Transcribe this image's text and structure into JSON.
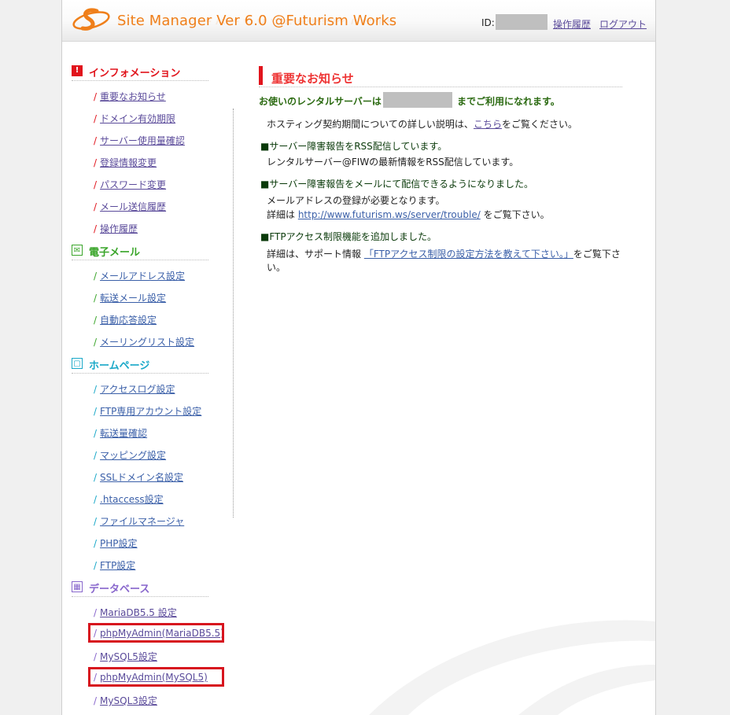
{
  "header": {
    "app_title": "Site Manager Ver 6.0 @Futurism Works",
    "id_label": "ID:",
    "history_link": "操作履歴",
    "logout_link": "ログアウト"
  },
  "sidebar": {
    "sections": [
      {
        "title": "インフォメーション",
        "icon": "exclamation-icon",
        "color": "#e1141c",
        "items": [
          "重要なお知らせ",
          "ドメイン有効期限",
          "サーバー使用量確認",
          "登録情報変更",
          "パスワード変更",
          "メール送信履歴",
          "操作履歴"
        ]
      },
      {
        "title": "電子メール",
        "icon": "envelope-icon",
        "color": "#3aa52a",
        "items": [
          "メールアドレス設定",
          "転送メール設定",
          "自動応答設定",
          "メーリングリスト設定"
        ]
      },
      {
        "title": "ホームページ",
        "icon": "window-icon",
        "color": "#19a8c8",
        "items": [
          "アクセスログ設定",
          "FTP専用アカウント設定",
          "転送量確認",
          "マッピング設定",
          "SSLドメイン名設定",
          ".htaccess設定",
          "ファイルマネージャ",
          "PHP設定",
          "FTP設定"
        ]
      },
      {
        "title": "データベース",
        "icon": "database-grid-icon",
        "color": "#8866cc",
        "items": [
          "MariaDB5.5 設定",
          "phpMyAdmin(MariaDB5.5)",
          "MySQL5設定",
          "phpMyAdmin(MySQL5)",
          "MySQL3設定"
        ]
      }
    ]
  },
  "main": {
    "notice_title": "重要なお知らせ",
    "rental_prefix": "お使いのレンタルサーバーは",
    "rental_suffix": "までご利用になれます。",
    "hosting_text_a": "ホスティング契約期間についての詳しい説明は、",
    "hosting_link": "こちら",
    "hosting_text_b": "をご覧ください。",
    "rss_head": "■サーバー障害報告をRSS配信しています。",
    "rss_body": "レンタルサーバー@FIWの最新情報をRSS配信しています。",
    "mail_head": "■サーバー障害報告をメールにて配信できるようになりました。",
    "mail_body1": "メールアドレスの登録が必要となります。",
    "mail_body2_a": "詳細は ",
    "mail_body2_link": "http://www.futurism.ws/server/trouble/",
    "mail_body2_b": " をご覧下さい。",
    "ftp_head": "■FTPアクセス制限機能を追加しました。",
    "ftp_body_a": "詳細は、サポート情報 ",
    "ftp_body_link": "「FTPアクセス制限の設定方法を教えて下さい。」",
    "ftp_body_b": "をご覧下さ",
    "ftp_body_c": "い。"
  },
  "colors": {
    "accent": "#ef7f1a",
    "highlight": "#d7141e",
    "link": "#5a4a9a"
  }
}
